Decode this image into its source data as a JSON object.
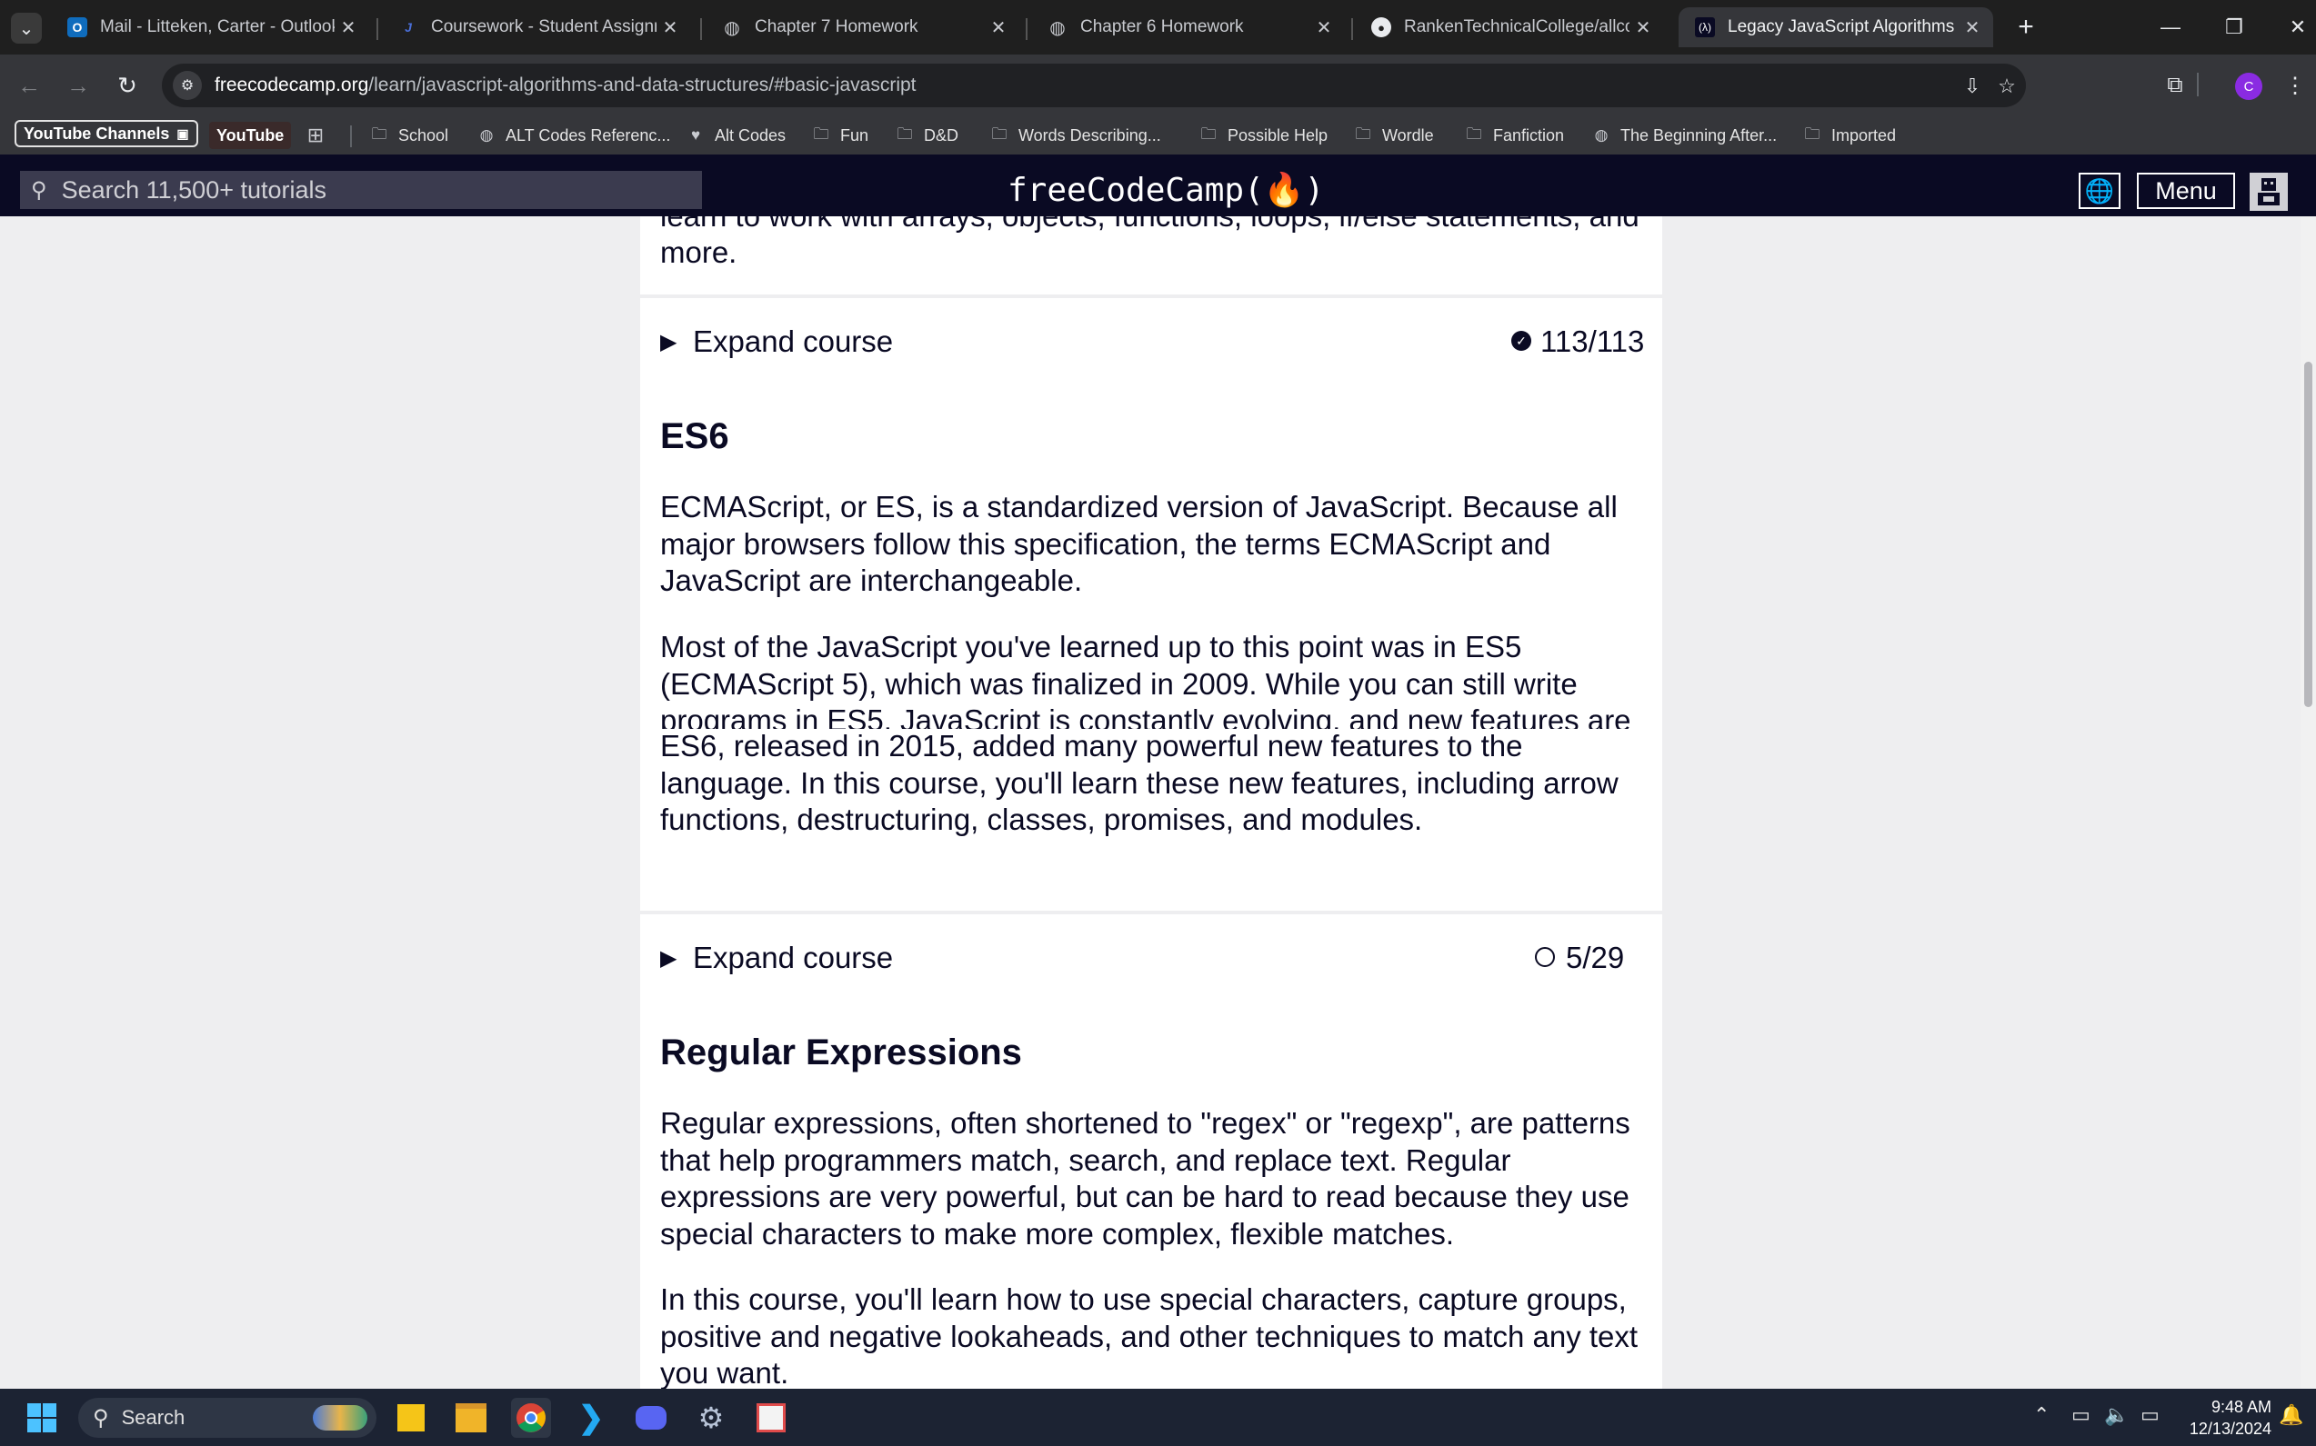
{
  "browser": {
    "tabs": [
      {
        "title": "Mail - Litteken, Carter - Outlook",
        "icon": "outlook-icon"
      },
      {
        "title": "Coursework - Student Assignments",
        "icon": "coursework-icon"
      },
      {
        "title": "Chapter 7 Homework",
        "icon": "globe-icon"
      },
      {
        "title": "Chapter 6 Homework",
        "icon": "globe-icon"
      },
      {
        "title": "RankenTechnicalCollege/allcourse",
        "icon": "github-icon"
      },
      {
        "title": "Legacy JavaScript Algorithms and",
        "icon": "freecodecamp-icon"
      }
    ],
    "url_domain": "freecodecamp.org",
    "url_path": "/learn/javascript-algorithms-and-data-structures/#basic-javascript",
    "profile_initial": "C",
    "bookmarks": [
      {
        "label": "YouTube Channels"
      },
      {
        "label": "YouTube"
      },
      {
        "label": "School"
      },
      {
        "label": "ALT Codes Referenc..."
      },
      {
        "label": "Alt Codes"
      },
      {
        "label": "Fun"
      },
      {
        "label": "D&D"
      },
      {
        "label": "Words Describing..."
      },
      {
        "label": "Possible Help"
      },
      {
        "label": "Wordle"
      },
      {
        "label": "Fanfiction"
      },
      {
        "label": "The Beginning After..."
      },
      {
        "label": "Imported"
      }
    ]
  },
  "fcc": {
    "search_placeholder": "Search 11,500+ tutorials",
    "logo": "freeCodeCamp(🔥)",
    "menu_label": "Menu"
  },
  "content": {
    "prev_tail_1": "learn to work with arrays, objects, functions, loops, if/else statements, and",
    "prev_tail_2": "more.",
    "expand_label": "Expand course",
    "basic_progress": "113/113",
    "es6": {
      "title": "ES6",
      "p1": "ECMAScript, or ES, is a standardized version of JavaScript. Because all major browsers follow this specification, the terms ECMAScript and JavaScript are interchangeable.",
      "p2": "Most of the JavaScript you've learned up to this point was in ES5 (ECMAScript 5), which was finalized in 2009. While you can still write programs in ES5, JavaScript is constantly evolving, and new features are released every year.",
      "p3": "ES6, released in 2015, added many powerful new features to the language. In this course, you'll learn these new features, including arrow functions, destructuring, classes, promises, and modules.",
      "progress": "5/29"
    },
    "regex": {
      "title": "Regular Expressions",
      "p1": "Regular expressions, often shortened to \"regex\" or \"regexp\", are patterns that help programmers match, search, and replace text. Regular expressions are very powerful, but can be hard to read because they use special characters to make more complex, flexible matches.",
      "p2": "In this course, you'll learn how to use special characters, capture groups, positive and negative lookaheads, and other techniques to match any text you want."
    }
  },
  "taskbar": {
    "search_label": "Search",
    "time": "9:48 AM",
    "date": "12/13/2024"
  }
}
